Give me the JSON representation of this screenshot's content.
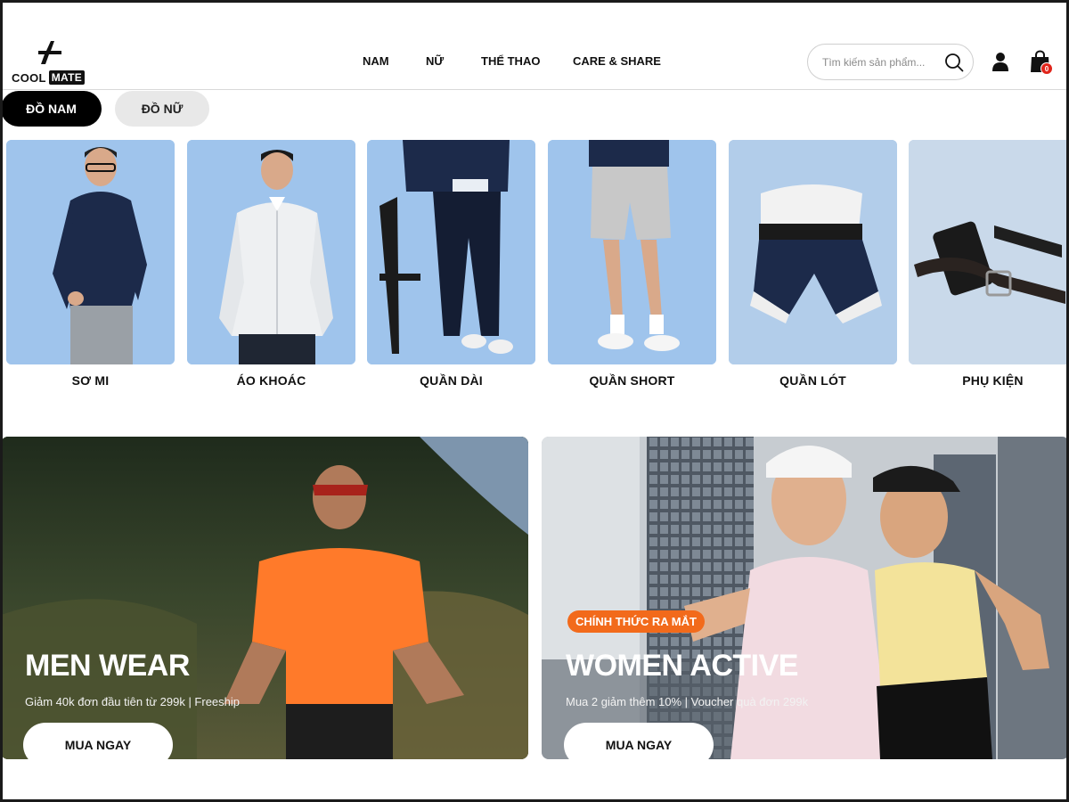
{
  "brand": {
    "name_part1": "COOL",
    "name_part2": "MATE"
  },
  "nav": {
    "items": [
      {
        "label": "NAM"
      },
      {
        "label": "NỮ"
      },
      {
        "label": "THỂ THAO"
      },
      {
        "label": "CARE & SHARE"
      }
    ]
  },
  "search": {
    "placeholder": "Tìm kiếm sản phẩm..."
  },
  "cart": {
    "count": "0"
  },
  "gender_tabs": [
    {
      "label": "ĐỒ NAM",
      "active": true
    },
    {
      "label": "ĐỒ NỮ",
      "active": false
    }
  ],
  "categories": [
    {
      "label": "SƠ MI"
    },
    {
      "label": "ÁO KHOÁC"
    },
    {
      "label": "QUẦN DÀI"
    },
    {
      "label": "QUẦN SHORT"
    },
    {
      "label": "QUẦN LÓT"
    },
    {
      "label": "PHỤ KIỆN"
    }
  ],
  "banners": [
    {
      "title": "MEN WEAR",
      "subtitle": "Giảm 40k đơn đầu tiên từ 299k | Freeship",
      "button": "MUA NGAY"
    },
    {
      "tag": "CHÍNH THỨC RA MẮT",
      "title": "WOMEN ACTIVE",
      "subtitle": "Mua 2 giảm thêm 10% | Voucher quà đơn 299k",
      "button": "MUA NGAY"
    }
  ],
  "colors": {
    "accent": "#f26a1b",
    "badge": "#e0251b",
    "card_bg": "#a9cbef"
  }
}
